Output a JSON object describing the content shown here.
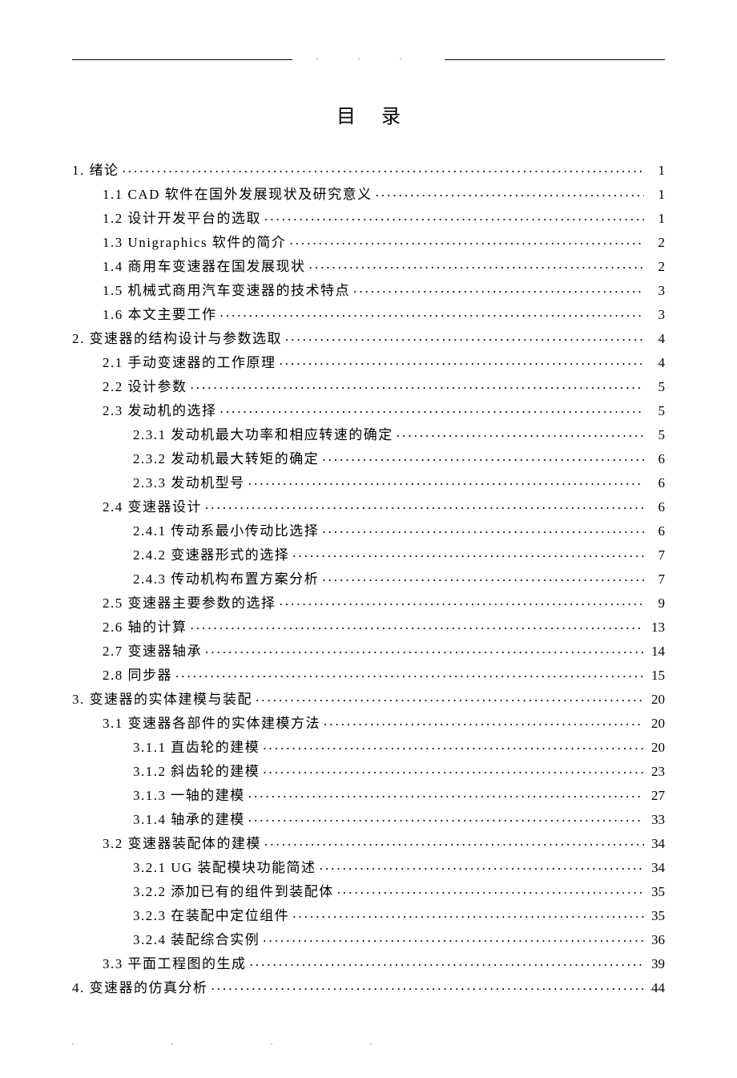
{
  "title": "目录",
  "entries": [
    {
      "level": 1,
      "label": "1. 绪论",
      "page": "1"
    },
    {
      "level": 2,
      "label": "1.1 CAD 软件在国外发展现状及研究意义",
      "page": "1"
    },
    {
      "level": 2,
      "label": "1.2 设计开发平台的选取",
      "page": "1"
    },
    {
      "level": 2,
      "label": "1.3 Unigraphics 软件的简介",
      "page": "2"
    },
    {
      "level": 2,
      "label": "1.4  商用车变速器在国发展现状",
      "page": "2"
    },
    {
      "level": 2,
      "label": "1.5  机械式商用汽车变速器的技术特点",
      "page": "3"
    },
    {
      "level": 2,
      "label": "1.6 本文主要工作",
      "page": "3"
    },
    {
      "level": 1,
      "label": "2. 变速器的结构设计与参数选取",
      "page": "4"
    },
    {
      "level": 2,
      "label": "2.1 手动变速器的工作原理",
      "page": "4"
    },
    {
      "level": 2,
      "label": "2.2 设计参数",
      "page": "5"
    },
    {
      "level": 2,
      "label": "2.3 发动机的选择",
      "page": "5"
    },
    {
      "level": 3,
      "label": "2.3.1 发动机最大功率和相应转速的确定",
      "page": "5"
    },
    {
      "level": 3,
      "label": "2.3.2 发动机最大转矩的确定",
      "page": "6"
    },
    {
      "level": 3,
      "label": "2.3.3 发动机型号",
      "page": "6"
    },
    {
      "level": 2,
      "label": "2.4 变速器设计",
      "page": "6"
    },
    {
      "level": 3,
      "label": "2.4.1 传动系最小传动比选择",
      "page": "6"
    },
    {
      "level": 3,
      "label": "2.4.2 变速器形式的选择",
      "page": "7"
    },
    {
      "level": 3,
      "label": "2.4.3 传动机构布置方案分析",
      "page": "7"
    },
    {
      "level": 2,
      "label": "2.5 变速器主要参数的选择",
      "page": "9"
    },
    {
      "level": 2,
      "label": "2.6 轴的计算",
      "page": "13"
    },
    {
      "level": 2,
      "label": "2.7 变速器轴承",
      "page": "14"
    },
    {
      "level": 2,
      "label": "2.8 同步器",
      "page": "15"
    },
    {
      "level": 1,
      "label": "3. 变速器的实体建模与装配",
      "page": "20"
    },
    {
      "level": 2,
      "label": "3.1 变速器各部件的实体建模方法",
      "page": "20"
    },
    {
      "level": 3,
      "label": "3.1.1 直齿轮的建模",
      "page": "20"
    },
    {
      "level": 3,
      "label": "3.1.2 斜齿轮的建模",
      "page": "23"
    },
    {
      "level": 3,
      "label": "3.1.3 一轴的建模",
      "page": "27"
    },
    {
      "level": 3,
      "label": "3.1.4 轴承的建模",
      "page": "33"
    },
    {
      "level": 2,
      "label": "3.2 变速器装配体的建模",
      "page": "34"
    },
    {
      "level": 3,
      "label": "3.2.1 UG 装配模块功能简述",
      "page": "34"
    },
    {
      "level": 3,
      "label": "3.2.2 添加已有的组件到装配体",
      "page": "35"
    },
    {
      "level": 3,
      "label": "3.2.3 在装配中定位组件",
      "page": "35"
    },
    {
      "level": 3,
      "label": "3.2.4 装配综合实例",
      "page": "36"
    },
    {
      "level": 2,
      "label": "3.3 平面工程图的生成",
      "page": "39"
    },
    {
      "level": 1,
      "label": "4. 变速器的仿真分析",
      "page": "44"
    }
  ]
}
